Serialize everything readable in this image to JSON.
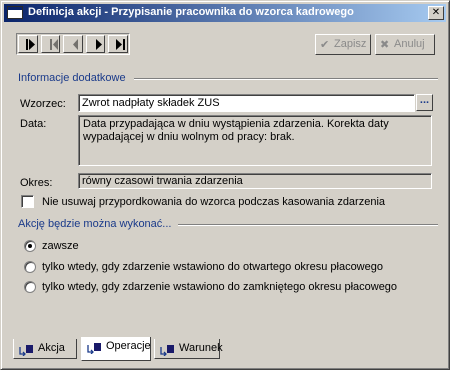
{
  "window": {
    "title": "Definicja akcji - Przypisanie pracownika do wzorca kadrowego",
    "close_glyph": "✕"
  },
  "toolbar": {
    "nav": [
      {
        "name": "first-record",
        "icon": "first-icon"
      },
      {
        "name": "previous-record",
        "icon": "previous-icon"
      },
      {
        "name": "next-record",
        "icon": "next-icon"
      },
      {
        "name": "last-record",
        "icon": "last-icon"
      }
    ],
    "save_label": "Zapisz",
    "cancel_label": "Anuluj"
  },
  "info": {
    "section_title": "Informacje dodatkowe",
    "template_label": "Wzorzec:",
    "template_value": "Zwrot nadpłaty składek ZUS",
    "template_button": "...",
    "date_label": "Data:",
    "date_value": "Data przypadająca w dniu wystąpienia zdarzenia. Korekta daty wypadającej w dniu wolnym od pracy: brak.",
    "period_label": "Okres:",
    "period_value": "równy czasowi trwania zdarzenia",
    "keep_assignment_label": "Nie usuwaj przypordkowania do wzorca podczas kasowania zdarzenia",
    "keep_assignment_checked": false
  },
  "execution": {
    "section_title": "Akcję będzie można wykonać...",
    "options": [
      {
        "label": "zawsze",
        "selected": true
      },
      {
        "label": "tylko wtedy, gdy zdarzenie wstawiono do otwartego okresu płacowego",
        "selected": false
      },
      {
        "label": "tylko wtedy, gdy zdarzenie wstawiono do zamkniętego okresu płacowego",
        "selected": false
      }
    ]
  },
  "tabs": [
    {
      "label": "Akcja",
      "active": false
    },
    {
      "label": "Operacje",
      "active": true
    },
    {
      "label": "Warunek",
      "active": false
    }
  ],
  "colors": {
    "accent": "#1a3a8a",
    "titlebar_start": "#0a246a",
    "titlebar_end": "#a6caf0",
    "face": "#d4d0c8"
  }
}
